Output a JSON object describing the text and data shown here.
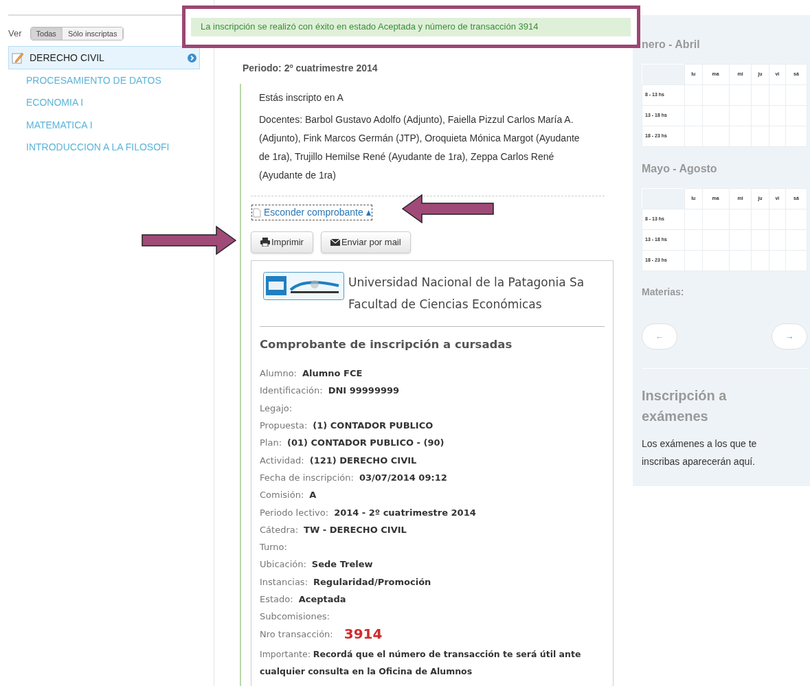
{
  "filter": {
    "label": "Ver",
    "options": [
      {
        "label": "Todas",
        "selected": true
      },
      {
        "label": "Sólo inscriptas",
        "selected": false
      }
    ]
  },
  "subjects": [
    {
      "name": "DERECHO CIVIL",
      "selected": true
    },
    {
      "name": "PROCESAMIENTO DE DATOS",
      "selected": false
    },
    {
      "name": "ECONOMIA I",
      "selected": false
    },
    {
      "name": "MATEMATICA I",
      "selected": false
    },
    {
      "name": "INTRODUCCION A LA FILOSOFI",
      "selected": false
    }
  ],
  "alert": "La inscripción se realizó con éxito en estado Aceptada y número de transacción 3914",
  "period": "Periodo: 2º cuatrimestre 2014",
  "enrollment": {
    "status": "Estás inscripto en A",
    "teachers": "Docentes: Barbol Gustavo Adolfo (Adjunto), Faiella Pizzul Carlos María A. (Adjunto), Fink Marcos Germán (JTP), Oroquieta Mónica Margot (Ayudante de 1ra), Trujillo Hemilse René (Ayudante de 1ra), Zeppa Carlos René (Ayudante de 1ra)",
    "toggle_link": "Esconder comprobante",
    "buttons": [
      {
        "label": "Imprimir",
        "kind": "print"
      },
      {
        "label": "Enviar por mail",
        "kind": "mail"
      }
    ]
  },
  "receipt": {
    "institution": "Universidad Nacional de la Patagonia Sa",
    "faculty": "Facultad de Ciencias Económicas",
    "title": "Comprobante de inscripción a cursadas",
    "fields": [
      {
        "label": "Alumno:",
        "value": "Alumno FCE",
        "kind": "text"
      },
      {
        "label": "Identificación:",
        "value": "DNI 99999999",
        "kind": "text"
      },
      {
        "label": "Legajo:",
        "kind": "text"
      },
      {
        "label": "Propuesta:",
        "value": "(1) CONTADOR PUBLICO",
        "kind": "text"
      },
      {
        "label": "Plan:",
        "value": "(01) CONTADOR PUBLICO - (90)",
        "kind": "text"
      },
      {
        "label": "Actividad:",
        "value": "(121) DERECHO CIVIL",
        "kind": "text"
      },
      {
        "label": "Fecha de inscripción:",
        "value": "03/07/2014 09:12",
        "kind": "text"
      },
      {
        "label": "Comisión:",
        "value": "A",
        "kind": "text"
      },
      {
        "label": "Periodo lectivo:",
        "value": "2014 - 2º cuatrimestre 2014",
        "kind": "text"
      },
      {
        "label": "Cátedra:",
        "value": "TW - DERECHO CIVIL",
        "kind": "text"
      },
      {
        "label": "Turno:",
        "kind": "text"
      },
      {
        "label": "Ubicación:",
        "value": "Sede Trelew",
        "kind": "text"
      },
      {
        "label": "Instancias:",
        "value": "Regularidad/Promoción",
        "kind": "text"
      },
      {
        "label": "Estado:",
        "value": "Aceptada",
        "kind": "text"
      },
      {
        "label": "Subcomisiones:",
        "kind": "text"
      },
      {
        "label": "Nro transacción:",
        "value": "3914",
        "kind": "highlight"
      }
    ],
    "note": "Importante:  **Recordá que el número de transacción te será útil ante cualquier consulta en la Oficina de Alumnos**"
  },
  "schedule": [
    {
      "title": "nero - Abril",
      "days": [
        "lu",
        "ma",
        "mi",
        "ju",
        "vi",
        "sá"
      ],
      "slots": [
        "8 - 13 hs",
        "13 - 18 hs",
        "18 - 23 hs"
      ]
    },
    {
      "title": "Mayo - Agosto",
      "days": [
        "lu",
        "ma",
        "mi",
        "ju",
        "vi",
        "sá"
      ],
      "slots": [
        "8 - 13 hs",
        "13 - 18 hs",
        "18 - 23 hs"
      ]
    }
  ],
  "subjects_panel": {
    "title": "Materias:",
    "nav": [
      {
        "label": "←",
        "kind": "prev"
      },
      {
        "label": "→",
        "kind": "next"
      }
    ]
  },
  "exams": {
    "title": "Inscripción a exámenes",
    "text": "Los exámenes a los que te inscribas aparecerán aquí."
  }
}
